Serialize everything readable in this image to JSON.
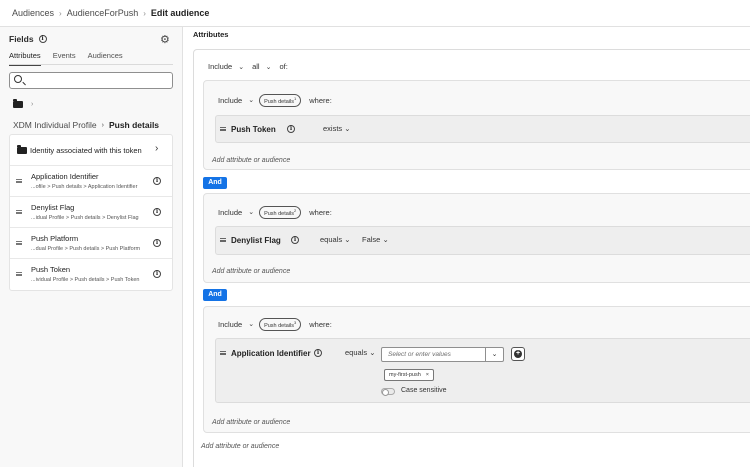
{
  "breadcrumb": {
    "item1": "Audiences",
    "item2": "AudienceForPush",
    "current": "Edit audience"
  },
  "left_panel": {
    "title": "Fields",
    "tabs": [
      "Attributes",
      "Events",
      "Audiences"
    ],
    "search": {
      "value": "",
      "placeholder": ""
    },
    "path": {
      "parent": "XDM Individual Profile",
      "current": "Push details"
    },
    "items": [
      {
        "name": "Identity associated with this token"
      },
      {
        "name": "Application Identifier",
        "path": "...ofile > Push details > Application Identifier"
      },
      {
        "name": "Denylist Flag",
        "path": "...idual Profile > Push details > Denylist Flag"
      },
      {
        "name": "Push Platform",
        "path": "...dual Profile > Push details > Push Platform"
      },
      {
        "name": "Push Token",
        "path": "...ividual Profile > Push details > Push Token"
      }
    ]
  },
  "main": {
    "title": "Attributes",
    "top_include": "Include",
    "top_quantifier": "all",
    "top_of": "of:",
    "groups": [
      {
        "include": "Include",
        "pill": "Push details",
        "pill_num": "1",
        "where": "where:",
        "field": "Push Token",
        "operator": "exists",
        "add_link": "Add attribute or audience"
      },
      {
        "include": "Include",
        "pill": "Push details",
        "pill_num": "2",
        "where": "where:",
        "field": "Denylist Flag",
        "operator": "equals",
        "value": "False",
        "add_link": "Add attribute or audience"
      },
      {
        "include": "Include",
        "pill": "Push details",
        "pill_num": "3",
        "where": "where:",
        "field": "Application Identifier",
        "operator": "equals",
        "value_placeholder": "Select or enter values",
        "tag": "my-first-push",
        "toggle_label": "Case sensitive",
        "add_link": "Add attribute or audience"
      }
    ],
    "and_label": "And",
    "outer_add_link": "Add attribute or audience"
  },
  "colors": {
    "accent": "#1473e6"
  }
}
